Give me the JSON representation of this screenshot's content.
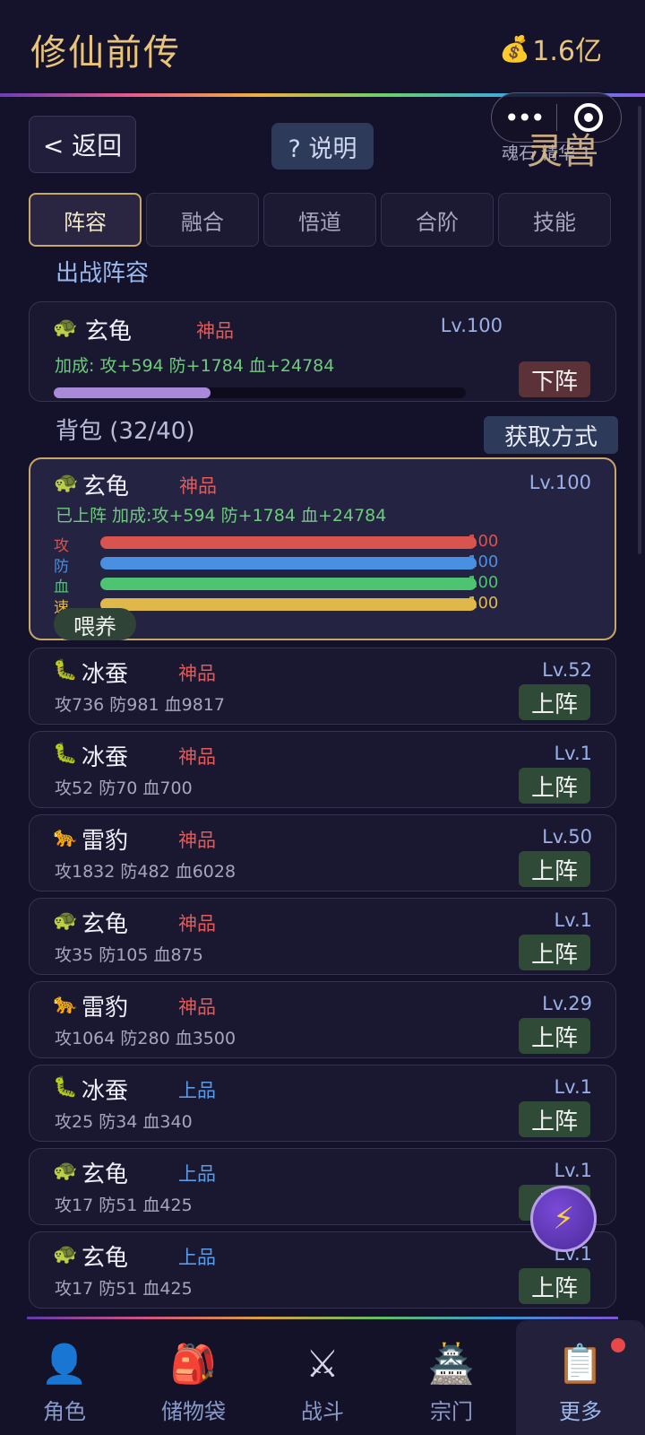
{
  "header": {
    "title": "修仙前传",
    "money_icon": "money-bag-icon",
    "money": "1.6亿"
  },
  "capsule": {
    "more": "•••",
    "close_icon": "target-icon"
  },
  "toolbar": {
    "back_label": "< 返回",
    "help_label": "? 说明",
    "stone_note": "魂石 精华 1",
    "panel_title": "灵兽"
  },
  "tabs": [
    {
      "label": "阵容",
      "active": true
    },
    {
      "label": "融合",
      "active": false
    },
    {
      "label": "悟道",
      "active": false
    },
    {
      "label": "合阶",
      "active": false
    },
    {
      "label": "技能",
      "active": false
    }
  ],
  "lineup": {
    "label": "出战阵容",
    "pet": {
      "icon": "turtle-icon",
      "name": "玄龟",
      "grade": "神品",
      "level": "Lv.100",
      "bonus": "加成: 攻+594 防+1784 血+24784",
      "action": "下阵",
      "exp_fraction": 0.38
    }
  },
  "bag": {
    "label": "背包 (32/40)",
    "get_label": "获取方式",
    "selected": {
      "icon": "turtle-icon",
      "name": "玄龟",
      "grade": "神品",
      "level": "Lv.100",
      "bonus": "已上阵 加成:攻+594 防+1784 血+24784",
      "attrs": [
        {
          "label": "攻",
          "value": "100",
          "fraction": 1.0,
          "color": "#d9534f"
        },
        {
          "label": "防",
          "value": "100",
          "fraction": 1.0,
          "color": "#4a90e2"
        },
        {
          "label": "血",
          "value": "100",
          "fraction": 1.0,
          "color": "#4cc472"
        },
        {
          "label": "速",
          "value": "100",
          "fraction": 1.0,
          "color": "#e0b84a"
        }
      ],
      "feed_label": "喂养"
    },
    "items": [
      {
        "icon": "silkworm-icon",
        "glyph": "🐛",
        "name": "冰蚕",
        "grade": "神品",
        "tier": "shen",
        "level": "Lv.52",
        "stats": "攻736 防981 血9817",
        "action": "上阵"
      },
      {
        "icon": "silkworm-icon",
        "glyph": "🐛",
        "name": "冰蚕",
        "grade": "神品",
        "tier": "shen",
        "level": "Lv.1",
        "stats": "攻52 防70 血700",
        "action": "上阵"
      },
      {
        "icon": "leopard-icon",
        "glyph": "🐆",
        "name": "雷豹",
        "grade": "神品",
        "tier": "shen",
        "level": "Lv.50",
        "stats": "攻1832 防482 血6028",
        "action": "上阵"
      },
      {
        "icon": "turtle-icon",
        "glyph": "🐢",
        "name": "玄龟",
        "grade": "神品",
        "tier": "shen",
        "level": "Lv.1",
        "stats": "攻35 防105 血875",
        "action": "上阵"
      },
      {
        "icon": "leopard-icon",
        "glyph": "🐆",
        "name": "雷豹",
        "grade": "神品",
        "tier": "shen",
        "level": "Lv.29",
        "stats": "攻1064 防280 血3500",
        "action": "上阵"
      },
      {
        "icon": "silkworm-icon",
        "glyph": "🐛",
        "name": "冰蚕",
        "grade": "上品",
        "tier": "shang",
        "level": "Lv.1",
        "stats": "攻25 防34 血340",
        "action": "上阵"
      },
      {
        "icon": "turtle-icon",
        "glyph": "🐢",
        "name": "玄龟",
        "grade": "上品",
        "tier": "shang",
        "level": "Lv.1",
        "stats": "攻17 防51 血425",
        "action": "上阵"
      },
      {
        "icon": "turtle-icon",
        "glyph": "🐢",
        "name": "玄龟",
        "grade": "上品",
        "tier": "shang",
        "level": "Lv.1",
        "stats": "攻17 防51 血425",
        "action": "上阵"
      }
    ]
  },
  "fab": {
    "icon": "lightning-icon"
  },
  "nav": [
    {
      "icon": "person-icon",
      "glyph": "👤",
      "label": "角色",
      "active": false
    },
    {
      "icon": "backpack-icon",
      "glyph": "🎒",
      "label": "储物袋",
      "active": false
    },
    {
      "icon": "crossed-swords-icon",
      "glyph": "⚔",
      "label": "战斗",
      "active": false
    },
    {
      "icon": "castle-icon",
      "glyph": "🏯",
      "label": "宗门",
      "active": false
    },
    {
      "icon": "clipboard-icon",
      "glyph": "📋",
      "label": "更多",
      "active": true
    }
  ]
}
